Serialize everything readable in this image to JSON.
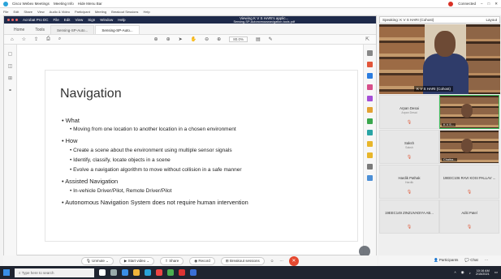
{
  "app": {
    "title": "Cisco Webex Meetings",
    "topbar_items": [
      "Meeting Info",
      "Hide Menu Bar"
    ],
    "connected": "Connected",
    "menu": [
      "File",
      "Edit",
      "Share",
      "View",
      "Audio & Video",
      "Participant",
      "Meeting",
      "Breakout Sessions",
      "Help"
    ]
  },
  "share_popup": {
    "line1": "Viewing K V S HARI's applic...",
    "line2": "Sensing-SP-Autonomousnavigation-tools.pdf"
  },
  "acrobat": {
    "title": "Acrobat Pro DC",
    "menu": [
      "File",
      "Edit",
      "View",
      "Sign",
      "Window",
      "Help"
    ],
    "nav": [
      "Home",
      "Tools"
    ],
    "tabs": [
      "Sensing-SP-Auto...",
      "Sensing-SP-Auto..."
    ],
    "zoom": "80.0%"
  },
  "slide": {
    "title": "Navigation",
    "bullets": [
      {
        "level": 1,
        "text": "What"
      },
      {
        "level": 2,
        "text": "Moving from one location to another location in a chosen environment"
      },
      {
        "level": 1,
        "text": "How"
      },
      {
        "level": 2,
        "text": "Create a scene about the environment using multiple sensor signals"
      },
      {
        "level": 2,
        "text": "Identify, classify, locate objects in a scene"
      },
      {
        "level": 2,
        "text": "Evolve a navigation algorithm to move without collision in a safe manner"
      },
      {
        "level": 1,
        "text": "Assisted Navigation"
      },
      {
        "level": 2,
        "text": "In-vehicle Driver/Pilot, Remote Driver/Pilot"
      },
      {
        "level": 1,
        "text": "Autonomous Navigation System does not require human intervention"
      }
    ]
  },
  "panel": {
    "speaking": "Speaking: K V S HARI (Cohost)",
    "layout_label": "Layout",
    "main_name": "K V S HARI (Cohost)",
    "tiles": [
      {
        "name": "Arpan Desai",
        "sub": "Arpan Desai",
        "video": false
      },
      {
        "name": "K V S...",
        "sub": "(Cohost)",
        "video": true,
        "active": true
      },
      {
        "name": "Saksh",
        "sub": "Saksh",
        "video": false
      },
      {
        "name": "Chaitra...",
        "sub": "(Cohost)",
        "video": true
      },
      {
        "name": "Hardik Pathak",
        "sub": "Hardik",
        "video": false
      },
      {
        "name": "19EEC106 RAVI KOSI PALLAV ...",
        "sub": "",
        "video": false
      },
      {
        "name": "19EEC149 ZINZUVADIYA AB...",
        "sub": "",
        "video": false
      },
      {
        "name": "Aditi Patel",
        "sub": "",
        "video": false
      }
    ],
    "participants_label": "Participants",
    "chat_label": "Chat"
  },
  "controls": {
    "unmute": "Unmute",
    "start_video": "Start video",
    "share": "Share",
    "record": "Record",
    "breakout": "Breakout sessions"
  },
  "taskbar": {
    "search_placeholder": "Type here to search",
    "time": "10:16 AM",
    "date": "2/15/2021"
  },
  "colors": {
    "webex_end": "#e5482f",
    "active_speaker": "#3fbf5c",
    "acrobat_title": "#1e2a4a"
  }
}
